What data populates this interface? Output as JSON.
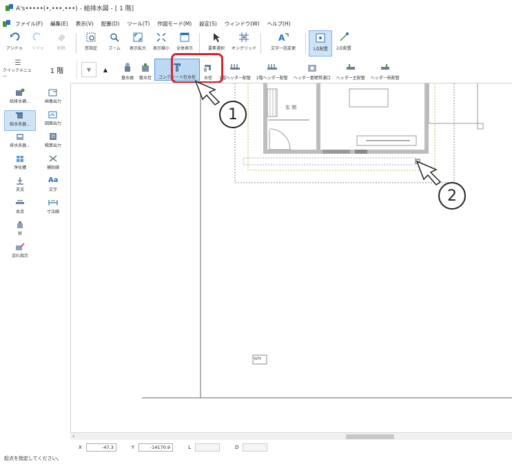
{
  "window": {
    "title": "A's•••••(•,•••,•••) - 給排水図 - [ 1 階]"
  },
  "menu": [
    "ファイル(F)",
    "編集(E)",
    "表示(V)",
    "配置(D)",
    "ツール(T)",
    "作図モード(M)",
    "設定(S)",
    "ウィンドウ(W)",
    "ヘルプ(H)"
  ],
  "toolbar1": [
    {
      "label": "アンドゥ",
      "icon": "undo-icon",
      "enabled": true
    },
    {
      "label": "リドゥ",
      "icon": "redo-icon",
      "enabled": false
    },
    {
      "label": "削除",
      "icon": "delete-icon",
      "enabled": false
    },
    {
      "label": "窓指定",
      "icon": "window-select-icon",
      "enabled": true
    },
    {
      "label": "ズーム",
      "icon": "zoom-icon",
      "enabled": true
    },
    {
      "label": "表示拡大",
      "icon": "zoom-in-icon",
      "enabled": true
    },
    {
      "label": "表示縮小",
      "icon": "zoom-out-icon",
      "enabled": true
    },
    {
      "label": "全体表示",
      "icon": "fit-icon",
      "enabled": true
    },
    {
      "label": "要素選択",
      "icon": "select-icon",
      "enabled": true
    },
    {
      "label": "オングリッド",
      "icon": "on-grid-icon",
      "enabled": true
    },
    {
      "label": "文字一括変更",
      "icon": "text-change-icon",
      "enabled": true
    },
    {
      "label": "1点配置",
      "icon": "one-point-icon",
      "enabled": true,
      "active": true
    },
    {
      "label": "2点配置",
      "icon": "two-point-icon",
      "enabled": true
    }
  ],
  "toolbar2": {
    "quick_label": "クイックメニュー",
    "floor": "1 階",
    "buttons": [
      {
        "label": "量水器",
        "icon": "water-meter-icon"
      },
      {
        "label": "散水栓",
        "icon": "sprinkler-tap-icon"
      },
      {
        "label": "コンクリート柱水栓",
        "icon": "concrete-faucet-icon",
        "selected": true
      },
      {
        "label": "水栓",
        "icon": "faucet-icon"
      },
      {
        "label": "1階ヘッダー配管",
        "icon": "header-1f-icon"
      },
      {
        "label": "2階ヘッダー配管",
        "icon": "header-2f-icon"
      },
      {
        "label": "ヘッダー基礎貫通口",
        "icon": "header-penetration-icon"
      },
      {
        "label": "ヘッダー主配管",
        "icon": "header-main-pipe-icon"
      },
      {
        "label": "ヘッダー枝配管",
        "icon": "header-branch-pipe-icon"
      }
    ]
  },
  "leftpanel": [
    {
      "label": "給排水補...",
      "icon": "plumbing-aux-icon"
    },
    {
      "label": "画像出力",
      "icon": "image-output-icon"
    },
    {
      "label": "給水系器...",
      "icon": "water-supply-icon",
      "active": true
    },
    {
      "label": "図面出力",
      "icon": "drawing-output-icon"
    },
    {
      "label": "排水系器...",
      "icon": "drainage-icon"
    },
    {
      "label": "積算出力",
      "icon": "estimate-output-icon"
    },
    {
      "label": "浄化槽",
      "icon": "septic-tank-icon"
    },
    {
      "label": "補助線",
      "icon": "aux-line-icon"
    },
    {
      "label": "支流",
      "icon": "branch-flow-icon"
    },
    {
      "label": "文字",
      "icon": "text-icon"
    },
    {
      "label": "本流",
      "icon": "main-flow-icon"
    },
    {
      "label": "寸法線",
      "icon": "dimension-icon"
    },
    {
      "label": "桝",
      "icon": "catch-basin-icon"
    },
    {
      "label": "流れ指示",
      "icon": "flow-direction-icon"
    }
  ],
  "canvas": {
    "room_label": "玄 関",
    "wm_label": "WM"
  },
  "status": {
    "x_label": "X",
    "x_value": "-47.3",
    "y_label": "Y",
    "y_value": "-14170.9",
    "l_label": "L",
    "d_label": "D"
  },
  "message": "起点を指定してください。",
  "callouts": {
    "one": "1",
    "two": "2"
  },
  "colors": {
    "highlight": "#d6242f",
    "selection": "#bcd9f4"
  }
}
